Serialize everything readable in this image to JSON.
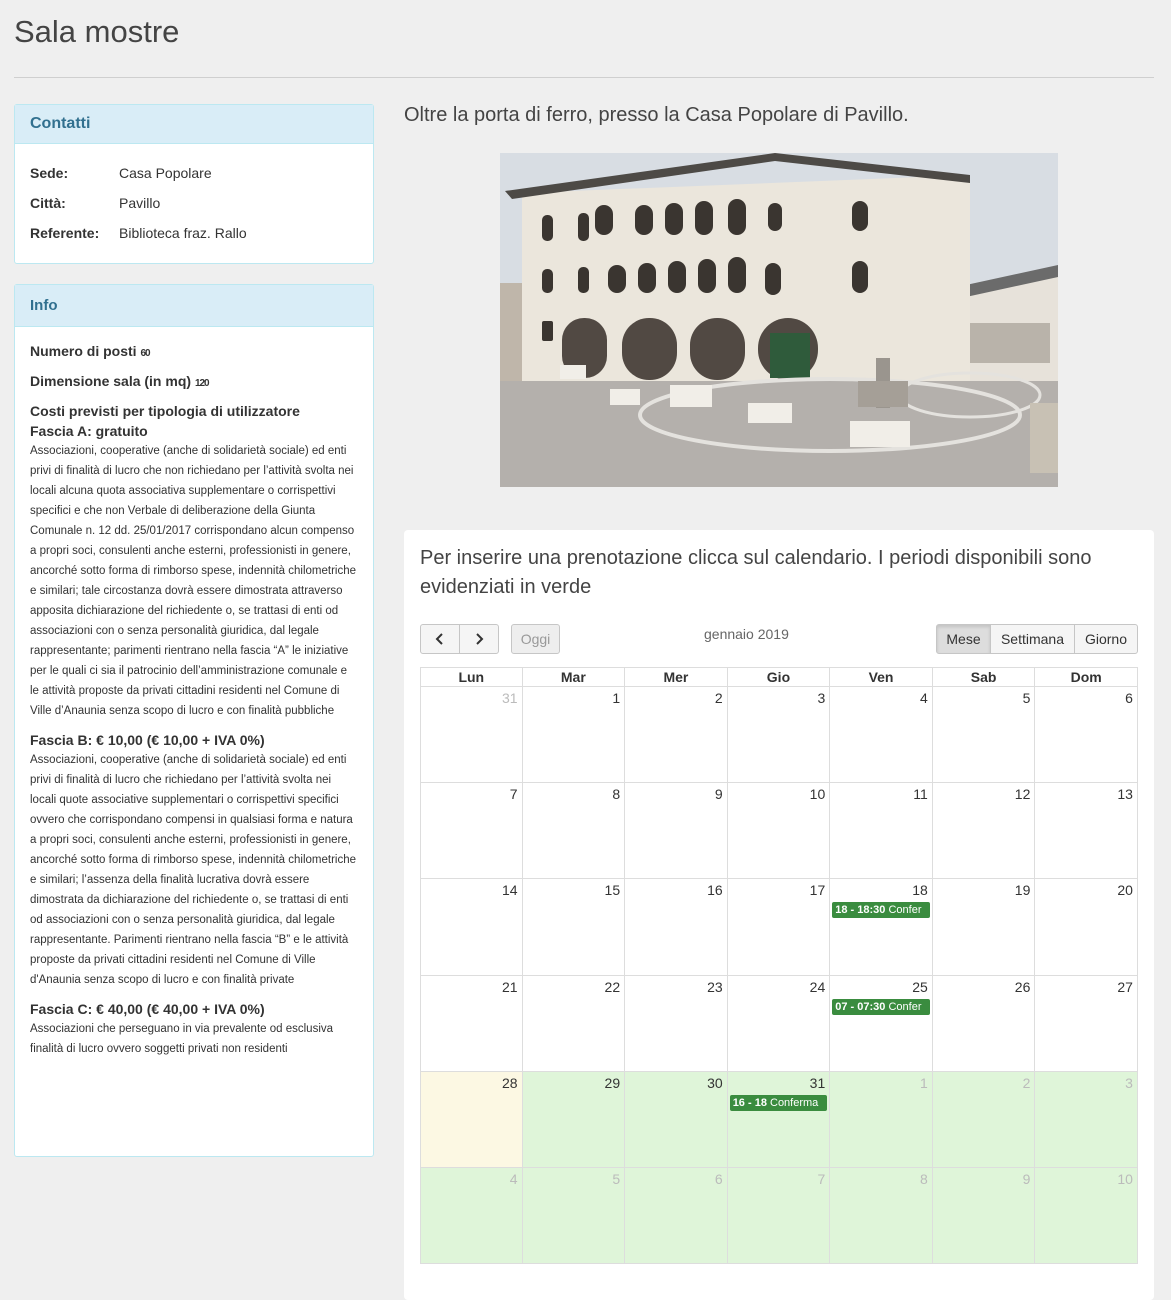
{
  "page": {
    "title": "Sala mostre"
  },
  "contacts": {
    "heading": "Contatti",
    "rows": [
      {
        "key": "Sede:",
        "value": "Casa Popolare"
      },
      {
        "key": "Città:",
        "value": "Pavillo"
      },
      {
        "key": "Referente:",
        "value": "Biblioteca fraz. Rallo"
      }
    ]
  },
  "info": {
    "heading": "Info",
    "seats_label": "Numero di posti",
    "seats_value": "60",
    "size_label": "Dimensione sala (in mq)",
    "size_value": "120",
    "costs_heading": "Costi previsti per tipologia di utilizzatore",
    "fascia_a_title": "Fascia A: gratuito",
    "fascia_a_text": "Associazioni, cooperative (anche di solidarietà sociale) ed enti privi di finalità di lucro che non richiedano per l’attività svolta nei locali alcuna quota associativa supplementare o corrispettivi specifici e che non Verbale di deliberazione della Giunta Comunale n. 12 dd. 25/01/2017 corrispondano alcun compenso a propri soci, consulenti anche esterni, professionisti in genere, ancorché sotto forma di rimborso spese, indennità chilometriche e similari; tale circostanza dovrà essere dimostrata attraverso apposita dichiarazione del richiedente o, se trattasi di enti od associazioni con o senza personalità giuridica, dal legale rappresentante; parimenti rientrano nella fascia “A” le iniziative per le quali ci sia il patrocinio dell’amministrazione comunale e le attività proposte da privati cittadini residenti nel Comune di Ville d’Anaunia senza scopo di lucro e con finalità pubbliche",
    "fascia_b_title": "Fascia B: € 10,00 (€ 10,00 + IVA 0%)",
    "fascia_b_text": "Associazioni, cooperative (anche di solidarietà sociale) ed enti privi di finalità di lucro che richiedano per l’attività svolta nei locali quote associative supplementari o corrispettivi specifici ovvero che corrispondano compensi in qualsiasi forma e natura a propri soci, consulenti anche esterni, professionisti in genere, ancorché sotto forma di rimborso spese, indennità chilometriche e similari; l’assenza della finalità lucrativa dovrà essere dimostrata da dichiarazione del richiedente o, se trattasi di enti od associazioni con o senza personalità giuridica, dal legale rappresentante. Parimenti rientrano nella fascia “B” e le attività proposte da privati cittadini residenti nel Comune di Ville d'Anaunia senza scopo di lucro e con finalità private",
    "fascia_c_title": "Fascia C: € 40,00 (€ 40,00 + IVA 0%)",
    "fascia_c_text": "Associazioni che perseguano in via prevalente od esclusiva finalità di lucro ovvero soggetti privati non residenti"
  },
  "main": {
    "lead": "Oltre la porta di ferro, presso la Casa Popolare di Pavillo."
  },
  "calendar": {
    "instructions": "Per inserire una prenotazione clicca sul calendario. I periodi disponibili sono evidenziati in verde",
    "today_label": "Oggi",
    "month_title": "gennaio 2019",
    "view_buttons": {
      "month": "Mese",
      "week": "Settimana",
      "day": "Giorno"
    },
    "weekdays": [
      "Lun",
      "Mar",
      "Mer",
      "Gio",
      "Ven",
      "Sab",
      "Dom"
    ],
    "weeks": [
      [
        {
          "n": "31",
          "s": "other"
        },
        {
          "n": "1"
        },
        {
          "n": "2"
        },
        {
          "n": "3"
        },
        {
          "n": "4"
        },
        {
          "n": "5"
        },
        {
          "n": "6"
        }
      ],
      [
        {
          "n": "7"
        },
        {
          "n": "8"
        },
        {
          "n": "9"
        },
        {
          "n": "10"
        },
        {
          "n": "11"
        },
        {
          "n": "12"
        },
        {
          "n": "13"
        }
      ],
      [
        {
          "n": "14"
        },
        {
          "n": "15"
        },
        {
          "n": "16"
        },
        {
          "n": "17"
        },
        {
          "n": "18",
          "ev": {
            "time": "18 - 18:30",
            "label": "Confer"
          }
        },
        {
          "n": "19"
        },
        {
          "n": "20"
        }
      ],
      [
        {
          "n": "21"
        },
        {
          "n": "22"
        },
        {
          "n": "23"
        },
        {
          "n": "24"
        },
        {
          "n": "25",
          "ev": {
            "time": "07 - 07:30",
            "label": "Confer"
          }
        },
        {
          "n": "26"
        },
        {
          "n": "27"
        }
      ],
      [
        {
          "n": "28",
          "s": "today"
        },
        {
          "n": "29",
          "s": "avail"
        },
        {
          "n": "30",
          "s": "avail"
        },
        {
          "n": "31",
          "s": "avail",
          "ev": {
            "time": "16 - 18",
            "label": "Conferma"
          }
        },
        {
          "n": "1",
          "s": "other avail"
        },
        {
          "n": "2",
          "s": "other avail"
        },
        {
          "n": "3",
          "s": "other avail"
        }
      ],
      [
        {
          "n": "4",
          "s": "other avail"
        },
        {
          "n": "5",
          "s": "other avail"
        },
        {
          "n": "6",
          "s": "other avail"
        },
        {
          "n": "7",
          "s": "other avail"
        },
        {
          "n": "8",
          "s": "other avail"
        },
        {
          "n": "9",
          "s": "other avail"
        },
        {
          "n": "10",
          "s": "other avail"
        }
      ]
    ]
  }
}
